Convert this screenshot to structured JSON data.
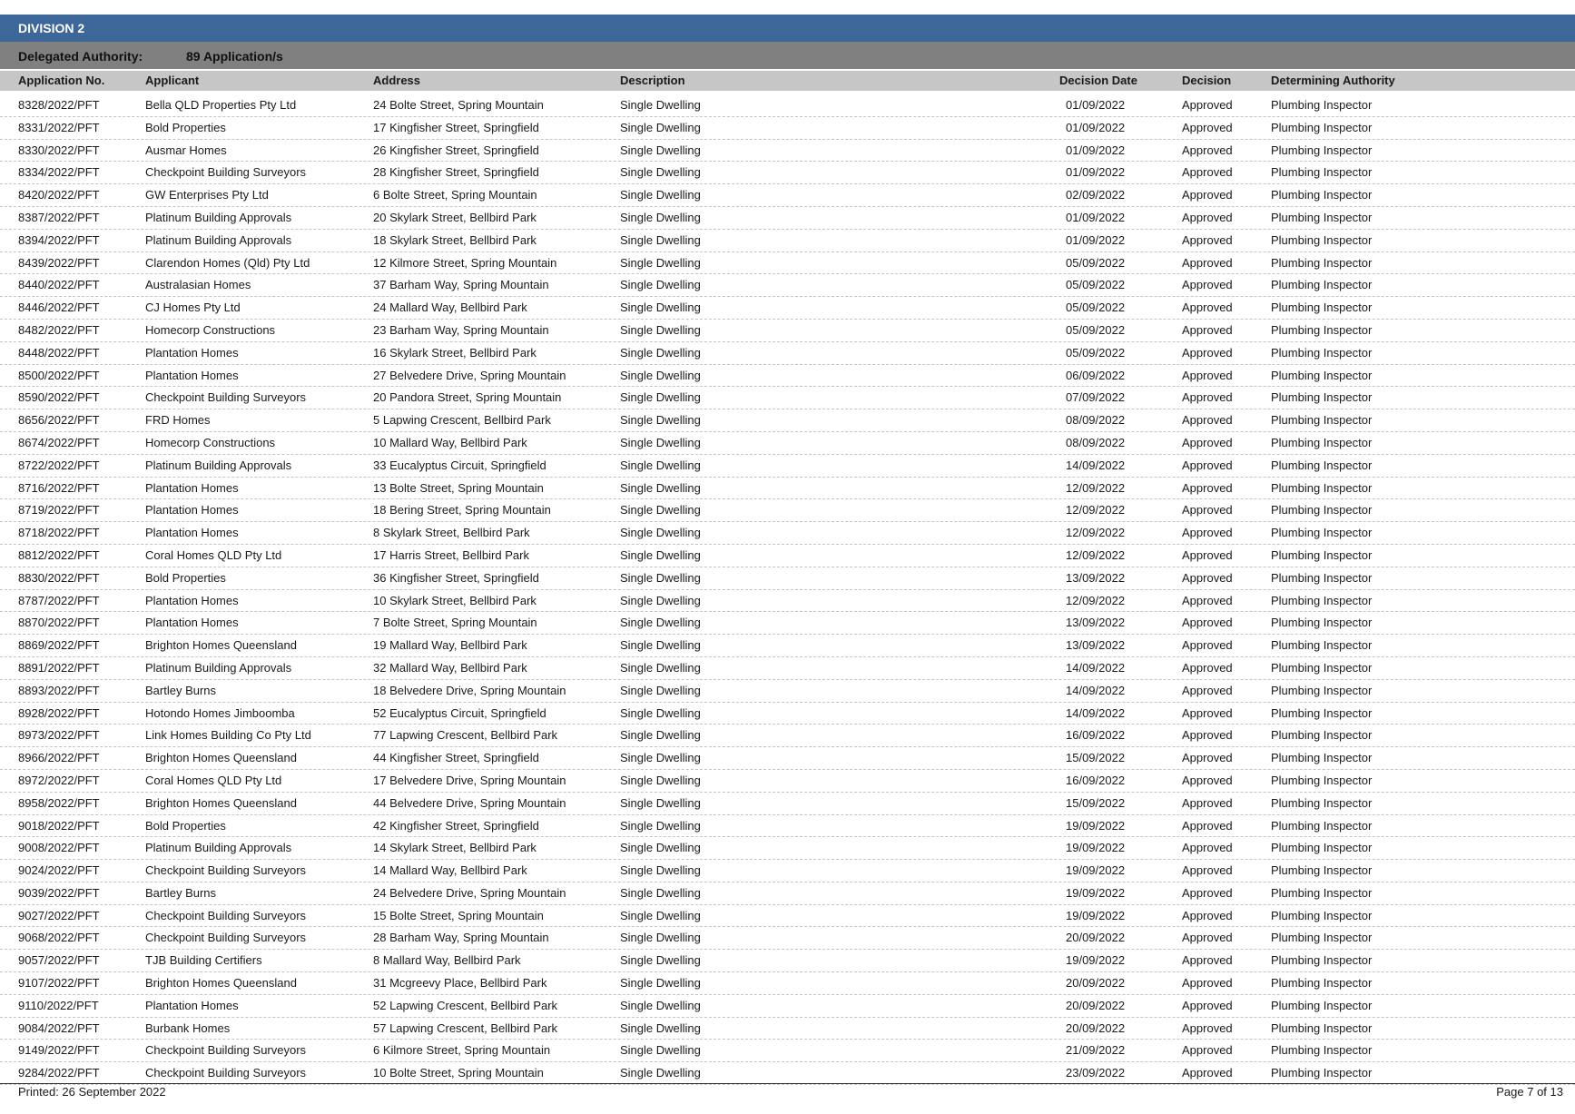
{
  "division": "DIVISION 2",
  "authority": {
    "label": "Delegated Authority:",
    "count": "89 Application/s"
  },
  "columns": {
    "app_no": "Application No.",
    "applicant": "Applicant",
    "address": "Address",
    "description": "Description",
    "decision_date": "Decision Date",
    "decision": "Decision",
    "authority": "Determining Authority"
  },
  "rows": [
    [
      "8328/2022/PFT",
      "Bella QLD Properties Pty Ltd",
      "24 Bolte Street, Spring Mountain",
      "Single Dwelling",
      "01/09/2022",
      "Approved",
      "Plumbing Inspector"
    ],
    [
      "8331/2022/PFT",
      "Bold Properties",
      "17 Kingfisher Street, Springfield",
      "Single Dwelling",
      "01/09/2022",
      "Approved",
      "Plumbing Inspector"
    ],
    [
      "8330/2022/PFT",
      "Ausmar Homes",
      "26 Kingfisher Street, Springfield",
      "Single Dwelling",
      "01/09/2022",
      "Approved",
      "Plumbing Inspector"
    ],
    [
      "8334/2022/PFT",
      "Checkpoint Building Surveyors",
      "28 Kingfisher Street, Springfield",
      "Single Dwelling",
      "01/09/2022",
      "Approved",
      "Plumbing Inspector"
    ],
    [
      "8420/2022/PFT",
      "GW Enterprises Pty Ltd",
      "6 Bolte Street, Spring Mountain",
      "Single Dwelling",
      "02/09/2022",
      "Approved",
      "Plumbing Inspector"
    ],
    [
      "8387/2022/PFT",
      "Platinum Building Approvals",
      "20 Skylark Street, Bellbird Park",
      "Single Dwelling",
      "01/09/2022",
      "Approved",
      "Plumbing Inspector"
    ],
    [
      "8394/2022/PFT",
      "Platinum Building Approvals",
      "18 Skylark Street, Bellbird Park",
      "Single Dwelling",
      "01/09/2022",
      "Approved",
      "Plumbing Inspector"
    ],
    [
      "8439/2022/PFT",
      "Clarendon Homes (Qld) Pty Ltd",
      "12 Kilmore Street, Spring Mountain",
      "Single Dwelling",
      "05/09/2022",
      "Approved",
      "Plumbing Inspector"
    ],
    [
      "8440/2022/PFT",
      "Australasian Homes",
      "37 Barham Way, Spring Mountain",
      "Single Dwelling",
      "05/09/2022",
      "Approved",
      "Plumbing Inspector"
    ],
    [
      "8446/2022/PFT",
      "CJ Homes Pty Ltd",
      "24 Mallard Way, Bellbird Park",
      "Single Dwelling",
      "05/09/2022",
      "Approved",
      "Plumbing Inspector"
    ],
    [
      "8482/2022/PFT",
      "Homecorp Constructions",
      "23 Barham Way, Spring Mountain",
      "Single Dwelling",
      "05/09/2022",
      "Approved",
      "Plumbing Inspector"
    ],
    [
      "8448/2022/PFT",
      "Plantation Homes",
      "16 Skylark Street, Bellbird Park",
      "Single Dwelling",
      "05/09/2022",
      "Approved",
      "Plumbing Inspector"
    ],
    [
      "8500/2022/PFT",
      "Plantation Homes",
      "27 Belvedere Drive, Spring Mountain",
      "Single Dwelling",
      "06/09/2022",
      "Approved",
      "Plumbing Inspector"
    ],
    [
      "8590/2022/PFT",
      "Checkpoint Building Surveyors",
      "20 Pandora Street, Spring Mountain",
      "Single Dwelling",
      "07/09/2022",
      "Approved",
      "Plumbing Inspector"
    ],
    [
      "8656/2022/PFT",
      "FRD Homes",
      "5 Lapwing Crescent, Bellbird Park",
      "Single Dwelling",
      "08/09/2022",
      "Approved",
      "Plumbing Inspector"
    ],
    [
      "8674/2022/PFT",
      "Homecorp Constructions",
      "10 Mallard Way, Bellbird Park",
      "Single Dwelling",
      "08/09/2022",
      "Approved",
      "Plumbing Inspector"
    ],
    [
      "8722/2022/PFT",
      "Platinum Building Approvals",
      "33 Eucalyptus Circuit, Springfield",
      "Single Dwelling",
      "14/09/2022",
      "Approved",
      "Plumbing Inspector"
    ],
    [
      "8716/2022/PFT",
      "Plantation Homes",
      "13 Bolte Street, Spring Mountain",
      "Single Dwelling",
      "12/09/2022",
      "Approved",
      "Plumbing Inspector"
    ],
    [
      "8719/2022/PFT",
      "Plantation Homes",
      "18 Bering Street, Spring Mountain",
      "Single Dwelling",
      "12/09/2022",
      "Approved",
      "Plumbing Inspector"
    ],
    [
      "8718/2022/PFT",
      "Plantation Homes",
      "8 Skylark Street, Bellbird Park",
      "Single Dwelling",
      "12/09/2022",
      "Approved",
      "Plumbing Inspector"
    ],
    [
      "8812/2022/PFT",
      "Coral Homes QLD Pty Ltd",
      "17 Harris Street, Bellbird Park",
      "Single Dwelling",
      "12/09/2022",
      "Approved",
      "Plumbing Inspector"
    ],
    [
      "8830/2022/PFT",
      "Bold Properties",
      "36 Kingfisher Street, Springfield",
      "Single Dwelling",
      "13/09/2022",
      "Approved",
      "Plumbing Inspector"
    ],
    [
      "8787/2022/PFT",
      "Plantation Homes",
      "10 Skylark Street, Bellbird Park",
      "Single Dwelling",
      "12/09/2022",
      "Approved",
      "Plumbing Inspector"
    ],
    [
      "8870/2022/PFT",
      "Plantation Homes",
      "7 Bolte Street, Spring Mountain",
      "Single Dwelling",
      "13/09/2022",
      "Approved",
      "Plumbing Inspector"
    ],
    [
      "8869/2022/PFT",
      "Brighton Homes Queensland",
      "19 Mallard Way, Bellbird Park",
      "Single Dwelling",
      "13/09/2022",
      "Approved",
      "Plumbing Inspector"
    ],
    [
      "8891/2022/PFT",
      "Platinum Building Approvals",
      "32 Mallard Way, Bellbird Park",
      "Single Dwelling",
      "14/09/2022",
      "Approved",
      "Plumbing Inspector"
    ],
    [
      "8893/2022/PFT",
      "Bartley Burns",
      "18 Belvedere Drive, Spring Mountain",
      "Single Dwelling",
      "14/09/2022",
      "Approved",
      "Plumbing Inspector"
    ],
    [
      "8928/2022/PFT",
      "Hotondo Homes Jimboomba",
      "52 Eucalyptus Circuit, Springfield",
      "Single Dwelling",
      "14/09/2022",
      "Approved",
      "Plumbing Inspector"
    ],
    [
      "8973/2022/PFT",
      "Link Homes Building Co Pty Ltd",
      "77 Lapwing Crescent, Bellbird Park",
      "Single Dwelling",
      "16/09/2022",
      "Approved",
      "Plumbing Inspector"
    ],
    [
      "8966/2022/PFT",
      "Brighton Homes Queensland",
      "44 Kingfisher Street, Springfield",
      "Single Dwelling",
      "15/09/2022",
      "Approved",
      "Plumbing Inspector"
    ],
    [
      "8972/2022/PFT",
      "Coral Homes QLD Pty Ltd",
      "17 Belvedere Drive, Spring Mountain",
      "Single Dwelling",
      "16/09/2022",
      "Approved",
      "Plumbing Inspector"
    ],
    [
      "8958/2022/PFT",
      "Brighton Homes Queensland",
      "44 Belvedere Drive, Spring Mountain",
      "Single Dwelling",
      "15/09/2022",
      "Approved",
      "Plumbing Inspector"
    ],
    [
      "9018/2022/PFT",
      "Bold Properties",
      "42 Kingfisher Street, Springfield",
      "Single Dwelling",
      "19/09/2022",
      "Approved",
      "Plumbing Inspector"
    ],
    [
      "9008/2022/PFT",
      "Platinum Building Approvals",
      "14 Skylark Street, Bellbird Park",
      "Single Dwelling",
      "19/09/2022",
      "Approved",
      "Plumbing Inspector"
    ],
    [
      "9024/2022/PFT",
      "Checkpoint Building Surveyors",
      "14 Mallard Way, Bellbird Park",
      "Single Dwelling",
      "19/09/2022",
      "Approved",
      "Plumbing Inspector"
    ],
    [
      "9039/2022/PFT",
      "Bartley Burns",
      "24 Belvedere Drive, Spring Mountain",
      "Single Dwelling",
      "19/09/2022",
      "Approved",
      "Plumbing Inspector"
    ],
    [
      "9027/2022/PFT",
      "Checkpoint Building Surveyors",
      "15 Bolte Street, Spring Mountain",
      "Single Dwelling",
      "19/09/2022",
      "Approved",
      "Plumbing Inspector"
    ],
    [
      "9068/2022/PFT",
      "Checkpoint Building Surveyors",
      "28 Barham Way, Spring Mountain",
      "Single Dwelling",
      "20/09/2022",
      "Approved",
      "Plumbing Inspector"
    ],
    [
      "9057/2022/PFT",
      "TJB Building Certifiers",
      "8 Mallard Way, Bellbird Park",
      "Single Dwelling",
      "19/09/2022",
      "Approved",
      "Plumbing Inspector"
    ],
    [
      "9107/2022/PFT",
      "Brighton Homes Queensland",
      "31 Mcgreevy Place, Bellbird Park",
      "Single Dwelling",
      "20/09/2022",
      "Approved",
      "Plumbing Inspector"
    ],
    [
      "9110/2022/PFT",
      "Plantation Homes",
      "52 Lapwing Crescent, Bellbird Park",
      "Single Dwelling",
      "20/09/2022",
      "Approved",
      "Plumbing Inspector"
    ],
    [
      "9084/2022/PFT",
      "Burbank Homes",
      "57 Lapwing Crescent, Bellbird Park",
      "Single Dwelling",
      "20/09/2022",
      "Approved",
      "Plumbing Inspector"
    ],
    [
      "9149/2022/PFT",
      "Checkpoint Building Surveyors",
      "6 Kilmore Street, Spring Mountain",
      "Single Dwelling",
      "21/09/2022",
      "Approved",
      "Plumbing Inspector"
    ],
    [
      "9284/2022/PFT",
      "Checkpoint Building Surveyors",
      "10 Bolte Street, Spring Mountain",
      "Single Dwelling",
      "23/09/2022",
      "Approved",
      "Plumbing Inspector"
    ]
  ],
  "footer": {
    "printed": "Printed: 26 September 2022",
    "page": "Page 7 of 13"
  }
}
